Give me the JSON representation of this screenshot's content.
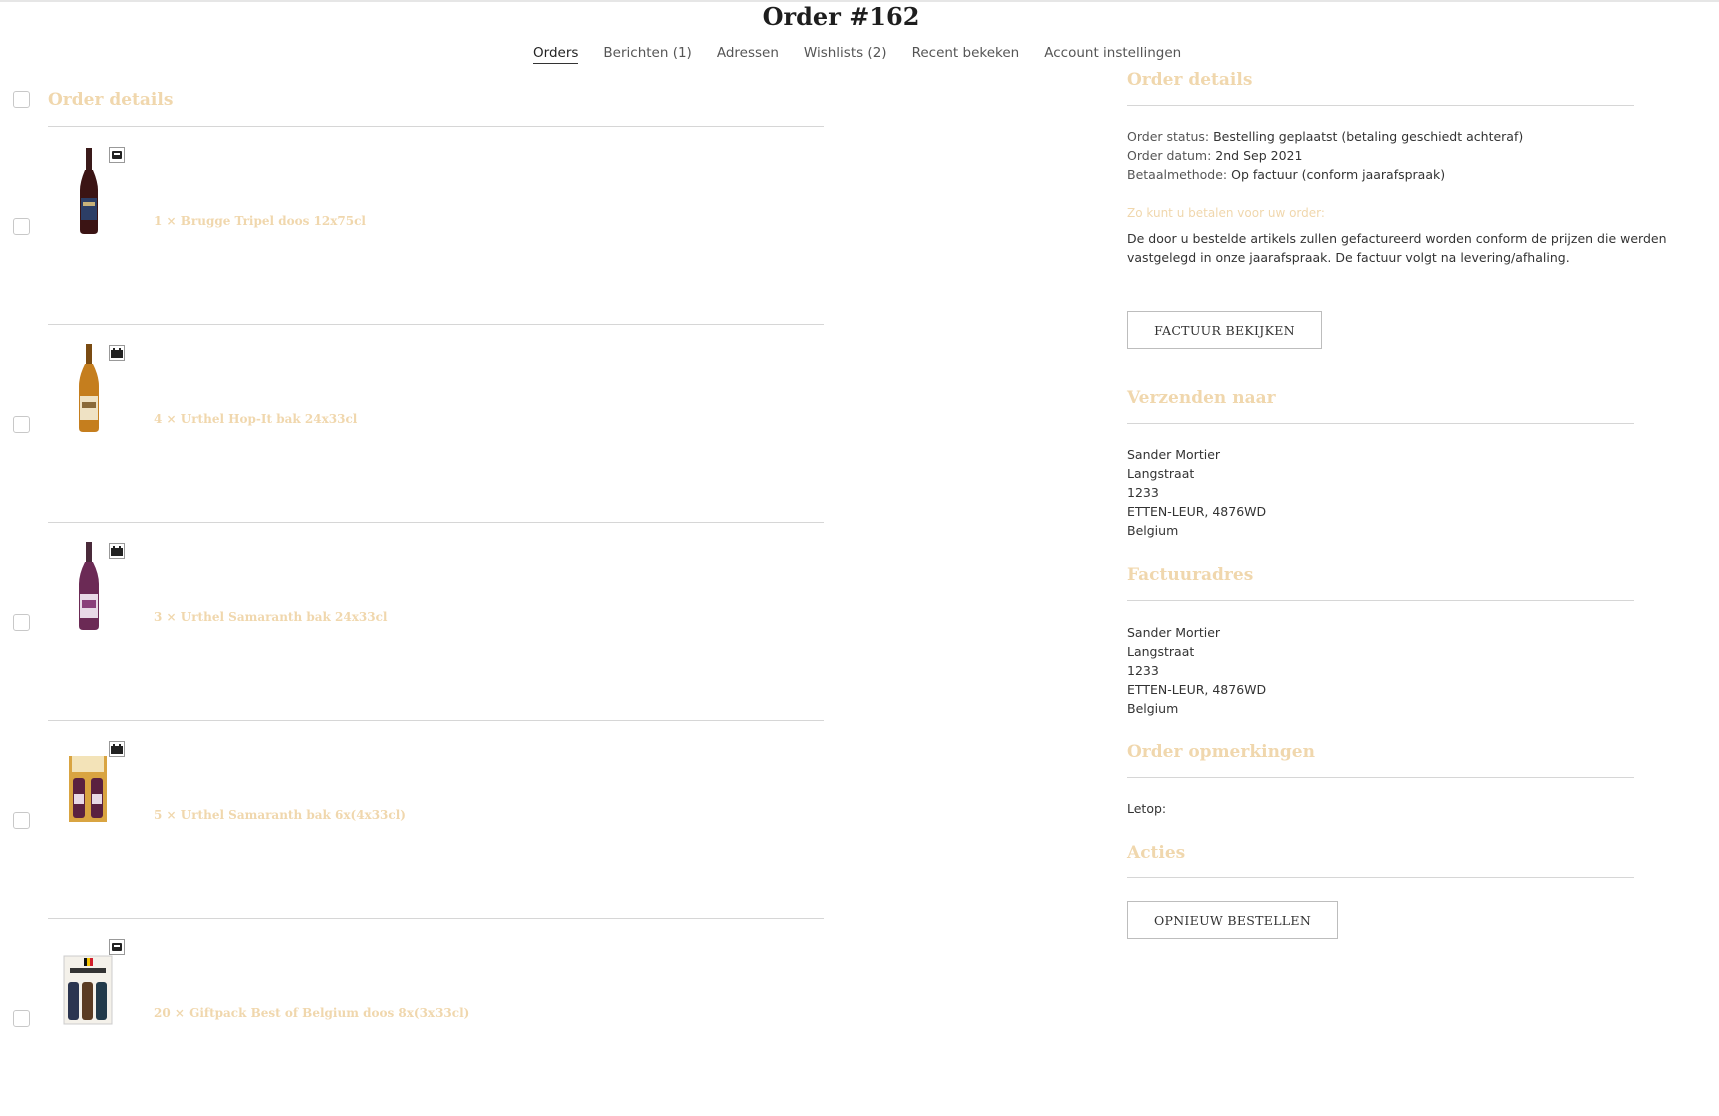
{
  "page": {
    "title": "Order #162"
  },
  "tabs": [
    {
      "label": "Orders",
      "active": true
    },
    {
      "label": "Berichten (1)",
      "active": false
    },
    {
      "label": "Adressen",
      "active": false
    },
    {
      "label": "Wishlists (2)",
      "active": false
    },
    {
      "label": "Recent bekeken",
      "active": false
    },
    {
      "label": "Account instellingen",
      "active": false
    }
  ],
  "left": {
    "heading": "Order details",
    "items": [
      {
        "title": "1 × Brugge Tripel doos 12x75cl",
        "product": "dark-bottle",
        "package_icon": "case-icon"
      },
      {
        "title": "4 × Urthel Hop-It bak 24x33cl",
        "product": "amber-bottle",
        "package_icon": "crate-icon"
      },
      {
        "title": "3 × Urthel Samaranth bak 24x33cl",
        "product": "purple-bottle",
        "package_icon": "crate-icon"
      },
      {
        "title": "5 × Urthel Samaranth bak 6x(4x33cl)",
        "product": "gift-pack",
        "package_icon": "crate-icon"
      },
      {
        "title": "20 × Giftpack Best of Belgium doos 8x(3x33cl)",
        "product": "best-of-belgium-pack",
        "package_icon": "case-icon"
      }
    ]
  },
  "right": {
    "order_details": {
      "heading": "Order details",
      "status_label": "Order status:",
      "status_value": "Bestelling geplaatst (betaling geschiedt achteraf)",
      "date_label": "Order datum:",
      "date_value": "2nd Sep 2021",
      "payment_label": "Betaalmethode:",
      "payment_value": "Op factuur (conform jaarafspraak)",
      "pay_hint": "Zo kunt u betalen voor uw order:",
      "pay_text_1": "De door u bestelde artikels zullen gefactureerd worden conform de prijzen die werden",
      "pay_text_2": "vastgelegd in onze jaarafspraak. De factuur volgt na levering/afhaling.",
      "invoice_button": "FACTUUR BEKIJKEN"
    },
    "shipping": {
      "heading": "Verzenden naar",
      "lines": [
        "Sander Mortier",
        "Langstraat",
        "1233",
        "ETTEN-LEUR, 4876WD",
        "Belgium"
      ]
    },
    "billing": {
      "heading": "Factuuradres",
      "lines": [
        "Sander Mortier",
        "Langstraat",
        "1233",
        "ETTEN-LEUR, 4876WD",
        "Belgium"
      ]
    },
    "remarks": {
      "heading": "Order opmerkingen",
      "text": "Letop:"
    },
    "actions": {
      "heading": "Acties",
      "reorder_button": "OPNIEUW BESTELLEN"
    }
  },
  "colors": {
    "accent": "#f0d7ad",
    "divider": "#d6d6d6",
    "text": "#333333"
  }
}
